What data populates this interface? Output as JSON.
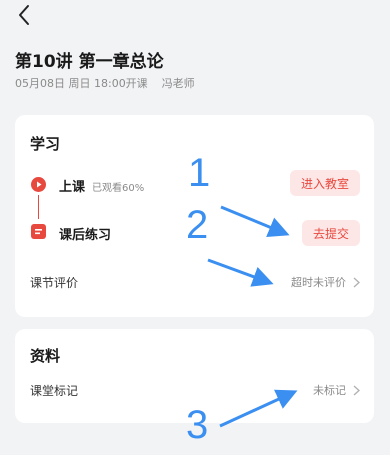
{
  "header": {
    "back_icon": "back-chevron-icon",
    "title": "第10讲 第一章总论",
    "date": "05月08日 周日 18:00开课",
    "teacher": "冯老师"
  },
  "study": {
    "title": "学习",
    "class": {
      "icon": "play-circle-icon",
      "label": "上课",
      "progress_text": "已观看60%",
      "button": "进入教室"
    },
    "exercise": {
      "icon": "document-icon",
      "label": "课后练习",
      "button": "去提交"
    },
    "evaluation": {
      "label": "课节评价",
      "status": "超时未评价"
    }
  },
  "material": {
    "title": "资料",
    "notes": {
      "label": "课堂标记",
      "status": "未标记"
    }
  },
  "annotations": {
    "one": "1",
    "two": "2",
    "three": "3",
    "arrow_color": "#3b8ff0"
  },
  "colors": {
    "accent": "#e8493f",
    "accent_bg": "#fde7e6",
    "page_bg": "#f2f3f5"
  }
}
